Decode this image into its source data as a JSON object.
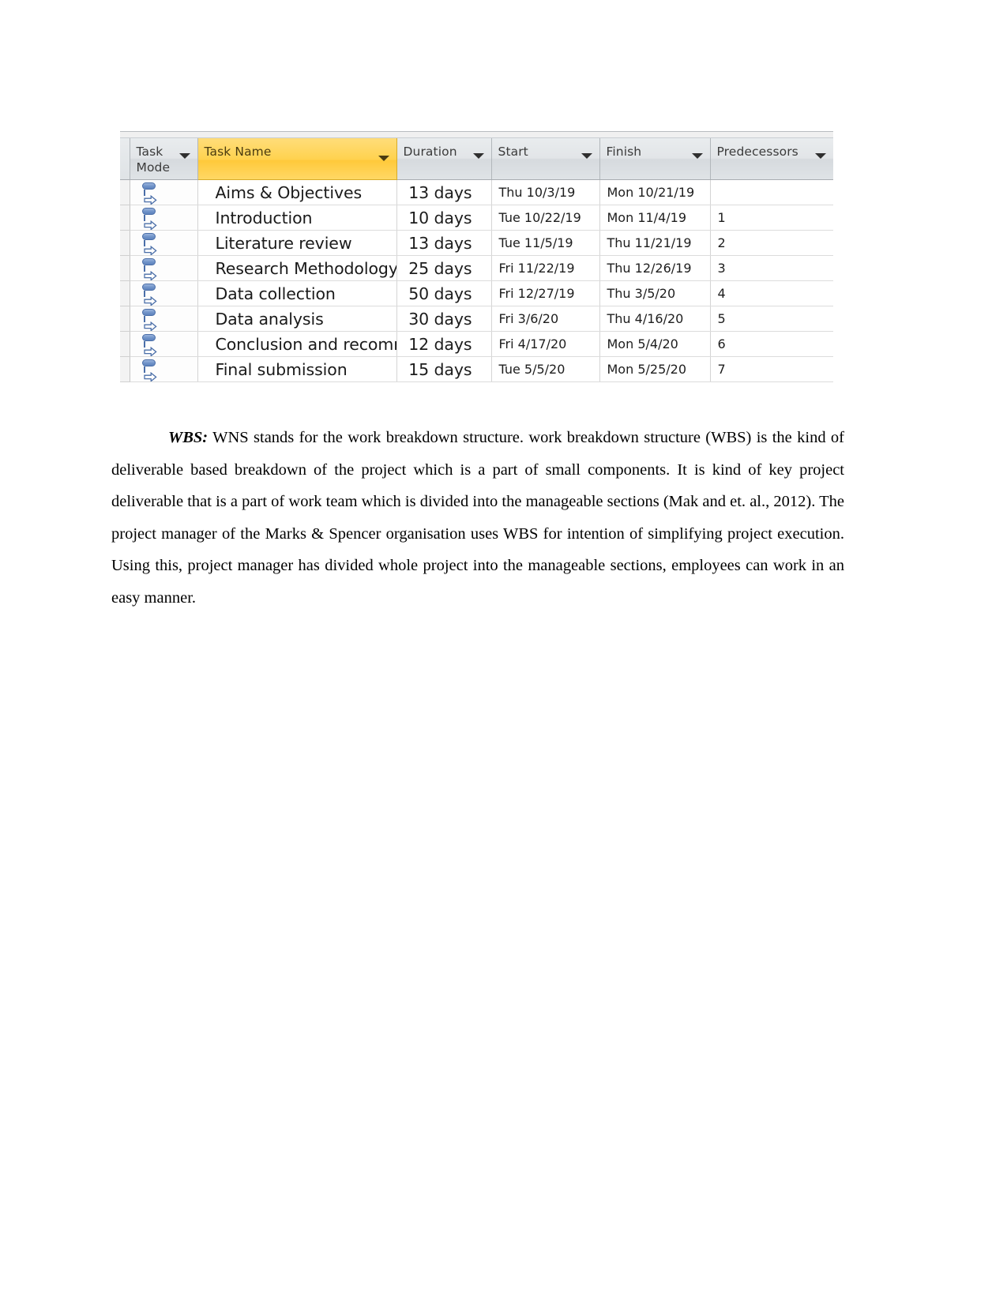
{
  "project_grid": {
    "columns": [
      {
        "key": "task_mode",
        "label": "Task\nMode",
        "has_filter": true,
        "highlighted": false
      },
      {
        "key": "task_name",
        "label": "Task Name",
        "has_filter": true,
        "highlighted": true
      },
      {
        "key": "duration",
        "label": "Duration",
        "has_filter": true,
        "highlighted": false
      },
      {
        "key": "start",
        "label": "Start",
        "has_filter": true,
        "highlighted": false
      },
      {
        "key": "finish",
        "label": "Finish",
        "has_filter": true,
        "highlighted": false
      },
      {
        "key": "predecessors",
        "label": "Predecessors",
        "has_filter": true,
        "highlighted": false
      }
    ],
    "header_highlight_color": "#ffd24e",
    "header_background_color": "#e2e5e8",
    "task_mode_icon": "auto-scheduled-icon",
    "rows": [
      {
        "task_mode": "auto-scheduled-icon",
        "task_name": "Aims & Objectives",
        "duration": "13 days",
        "start": "Thu 10/3/19",
        "finish": "Mon 10/21/19",
        "predecessors": ""
      },
      {
        "task_mode": "auto-scheduled-icon",
        "task_name": "Introduction",
        "duration": "10 days",
        "start": "Tue 10/22/19",
        "finish": "Mon 11/4/19",
        "predecessors": "1"
      },
      {
        "task_mode": "auto-scheduled-icon",
        "task_name": "Literature review",
        "duration": "13 days",
        "start": "Tue 11/5/19",
        "finish": "Thu 11/21/19",
        "predecessors": "2"
      },
      {
        "task_mode": "auto-scheduled-icon",
        "task_name": "Research Methodology",
        "duration": "25 days",
        "start": "Fri 11/22/19",
        "finish": "Thu 12/26/19",
        "predecessors": "3"
      },
      {
        "task_mode": "auto-scheduled-icon",
        "task_name": "Data collection",
        "duration": "50 days",
        "start": "Fri 12/27/19",
        "finish": "Thu 3/5/20",
        "predecessors": "4"
      },
      {
        "task_mode": "auto-scheduled-icon",
        "task_name": "Data analysis",
        "duration": "30 days",
        "start": "Fri 3/6/20",
        "finish": "Thu 4/16/20",
        "predecessors": "5"
      },
      {
        "task_mode": "auto-scheduled-icon",
        "task_name": "Conclusion and recommendation",
        "duration": "12 days",
        "start": "Fri 4/17/20",
        "finish": "Mon 5/4/20",
        "predecessors": "6"
      },
      {
        "task_mode": "auto-scheduled-icon",
        "task_name": "Final submission",
        "duration": "15 days",
        "start": "Tue 5/5/20",
        "finish": "Mon 5/25/20",
        "predecessors": "7"
      }
    ]
  },
  "document": {
    "paragraph_lead": "WBS:",
    "paragraph_text": " WNS stands for the work breakdown structure. work breakdown structure (WBS) is the  kind of deliverable based breakdown of the project which is a part of small components. It is kind of key project deliverable that is a part of work team which is divided into the manageable sections (Mak and et. al., 2012). The project manager of the Marks & Spencer organisation uses WBS for intention of simplifying project execution. Using this, project manager has divided whole project into the manageable sections, employees can work in an easy manner."
  }
}
